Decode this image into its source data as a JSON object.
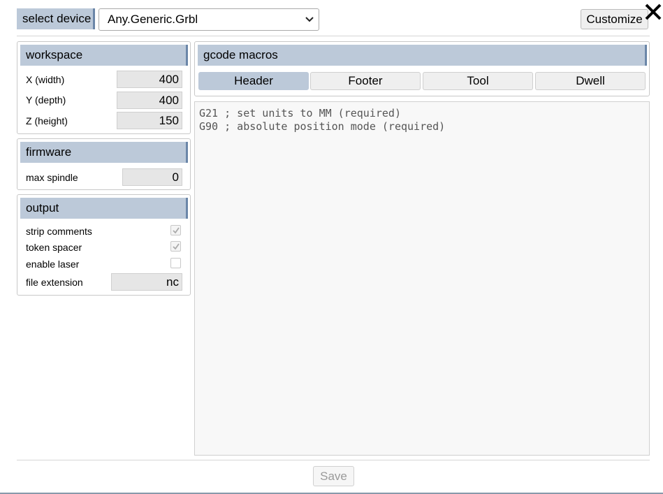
{
  "header": {
    "select_device_label": "select device",
    "device_selected": "Any.Generic.Grbl",
    "customize_label": "Customize"
  },
  "workspace": {
    "title": "workspace",
    "x_label": "X (width)",
    "x_value": "400",
    "y_label": "Y (depth)",
    "y_value": "400",
    "z_label": "Z (height)",
    "z_value": "150"
  },
  "firmware": {
    "title": "firmware",
    "max_spindle_label": "max spindle",
    "max_spindle_value": "0"
  },
  "output": {
    "title": "output",
    "strip_comments_label": "strip comments",
    "strip_comments_checked": true,
    "token_spacer_label": "token spacer",
    "token_spacer_checked": true,
    "enable_laser_label": "enable laser",
    "enable_laser_checked": false,
    "file_extension_label": "file extension",
    "file_extension_value": "nc"
  },
  "macros": {
    "title": "gcode macros",
    "tabs": [
      "Header",
      "Footer",
      "Tool",
      "Dwell"
    ],
    "active_tab": "Header",
    "code": "G21 ; set units to MM (required)\nG90 ; absolute position mode (required)"
  },
  "footer": {
    "save_label": "Save"
  },
  "icons": {
    "close": "close-icon",
    "dropdown": "chevron-down-icon",
    "check": "check-icon"
  },
  "colors": {
    "label_bg": "#bcc9d9",
    "label_accent": "#6b86a8"
  }
}
